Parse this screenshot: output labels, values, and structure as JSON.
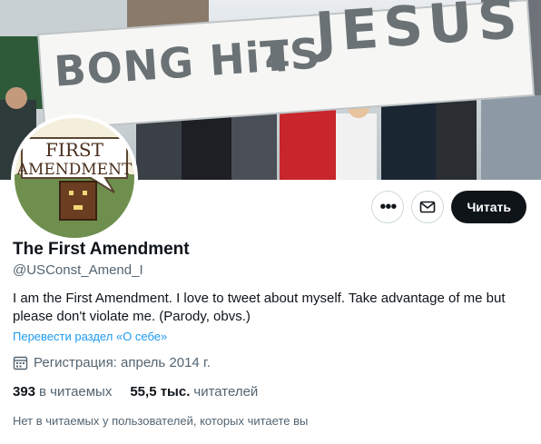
{
  "banner": {
    "sign_text_line1": "BONG HiTS",
    "sign_text_line2": "4",
    "sign_text_line3": "JESUS"
  },
  "avatar": {
    "line1": "FIRST",
    "line2": "AMENDMENT"
  },
  "actions": {
    "more_icon": "more-horizontal-icon",
    "message_icon": "mail-icon",
    "follow_label": "Читать"
  },
  "profile": {
    "name": "The First Amendment",
    "handle": "@USConst_Amend_I",
    "bio": "I am the First Amendment. I love to tweet about myself. Take advantage of me but please don't violate me. (Parody, obvs.)",
    "translate_label": "Перевести раздел «О себе»",
    "joined": "Регистрация: апрель 2014 г.",
    "following_count": "393",
    "following_label": "в читаемых",
    "followers_count": "55,5 тыс.",
    "followers_label": "читателей",
    "followed_by_note": "Нет в читаемых у пользователей, которых читаете вы"
  },
  "colors": {
    "link": "#1d9bf0",
    "secondary_text": "#536471",
    "primary_text": "#0f1419",
    "button_dark": "#0f1419"
  }
}
